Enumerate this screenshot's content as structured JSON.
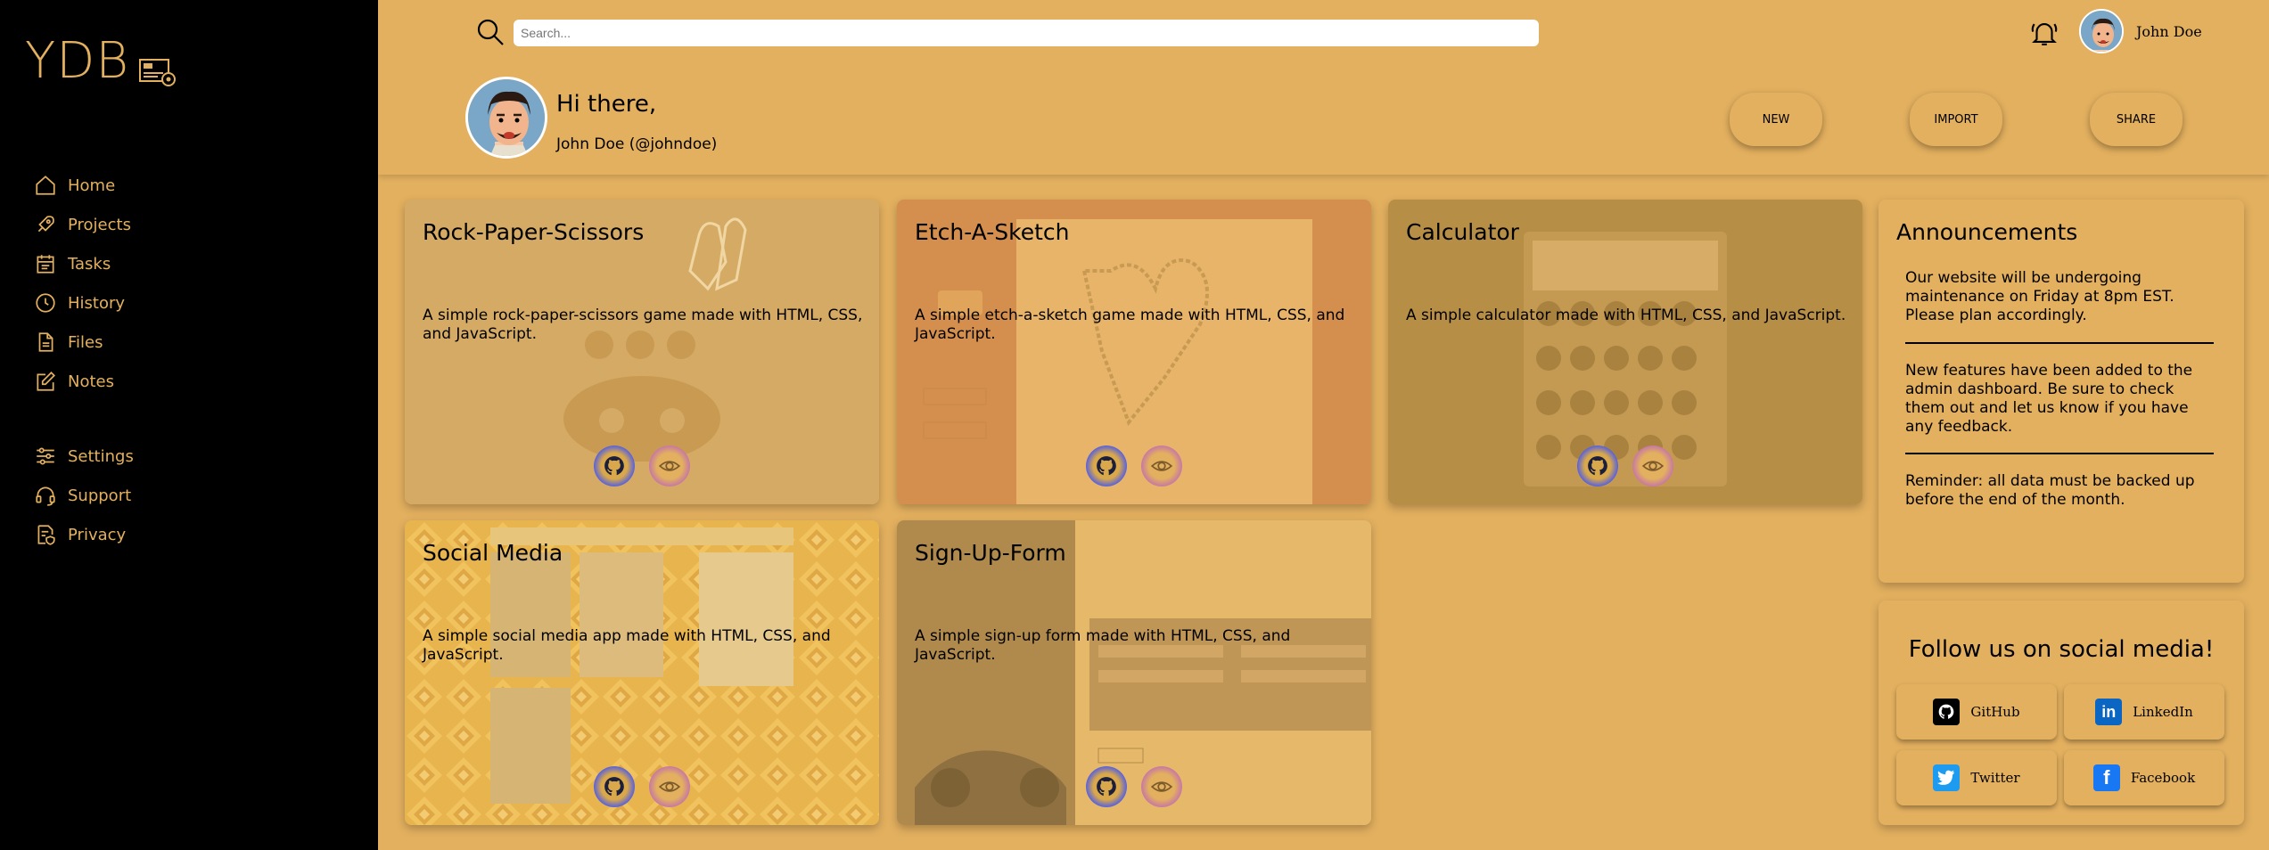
{
  "brand": {
    "logo_text": "YDB"
  },
  "sidebar": {
    "items": [
      {
        "label": "Home",
        "icon": "home-icon"
      },
      {
        "label": "Projects",
        "icon": "rocket-icon"
      },
      {
        "label": "Tasks",
        "icon": "calendar-icon"
      },
      {
        "label": "History",
        "icon": "history-icon"
      },
      {
        "label": "Files",
        "icon": "files-icon"
      },
      {
        "label": "Notes",
        "icon": "notes-icon"
      }
    ],
    "settings_items": [
      {
        "label": "Settings",
        "icon": "sliders-icon"
      },
      {
        "label": "Support",
        "icon": "headset-icon"
      },
      {
        "label": "Privacy",
        "icon": "privacy-icon"
      }
    ]
  },
  "header": {
    "search_placeholder": "Search...",
    "user_name": "John Doe",
    "greeting": "Hi there,",
    "handle": "John Doe (@johndoe)",
    "buttons": {
      "new": "NEW",
      "import": "IMPORT",
      "share": "SHARE"
    }
  },
  "projects": [
    {
      "title": "Rock-Paper-Scissors",
      "description": "A simple rock-paper-scissors game made with HTML, CSS, and JavaScript."
    },
    {
      "title": "Etch-A-Sketch",
      "description": "A simple etch-a-sketch game made with HTML, CSS, and JavaScript."
    },
    {
      "title": "Calculator",
      "description": "A simple calculator made with HTML, CSS, and JavaScript."
    },
    {
      "title": "Social Media",
      "description": "A simple social media app made with HTML, CSS, and JavaScript."
    },
    {
      "title": "Sign-Up-Form",
      "description": "A simple sign-up form made with HTML, CSS, and JavaScript."
    }
  ],
  "announcements": {
    "title": "Announcements",
    "items": [
      "Our website will be undergoing maintenance on Friday at 8pm EST. Please plan accordingly.",
      "New features have been added to the admin dashboard. Be sure to check them out and let us know if you have any feedback.",
      "Reminder: all data must be backed up before the end of the month."
    ]
  },
  "social": {
    "title": "Follow us on social media!",
    "links": [
      {
        "label": "GitHub",
        "color": "#000000"
      },
      {
        "label": "LinkedIn",
        "color": "#0a66c2"
      },
      {
        "label": "Twitter",
        "color": "#1d9bf0"
      },
      {
        "label": "Facebook",
        "color": "#1877f2"
      }
    ]
  },
  "colors": {
    "accent": "#e3b05f",
    "sidebar_bg": "#000000"
  }
}
